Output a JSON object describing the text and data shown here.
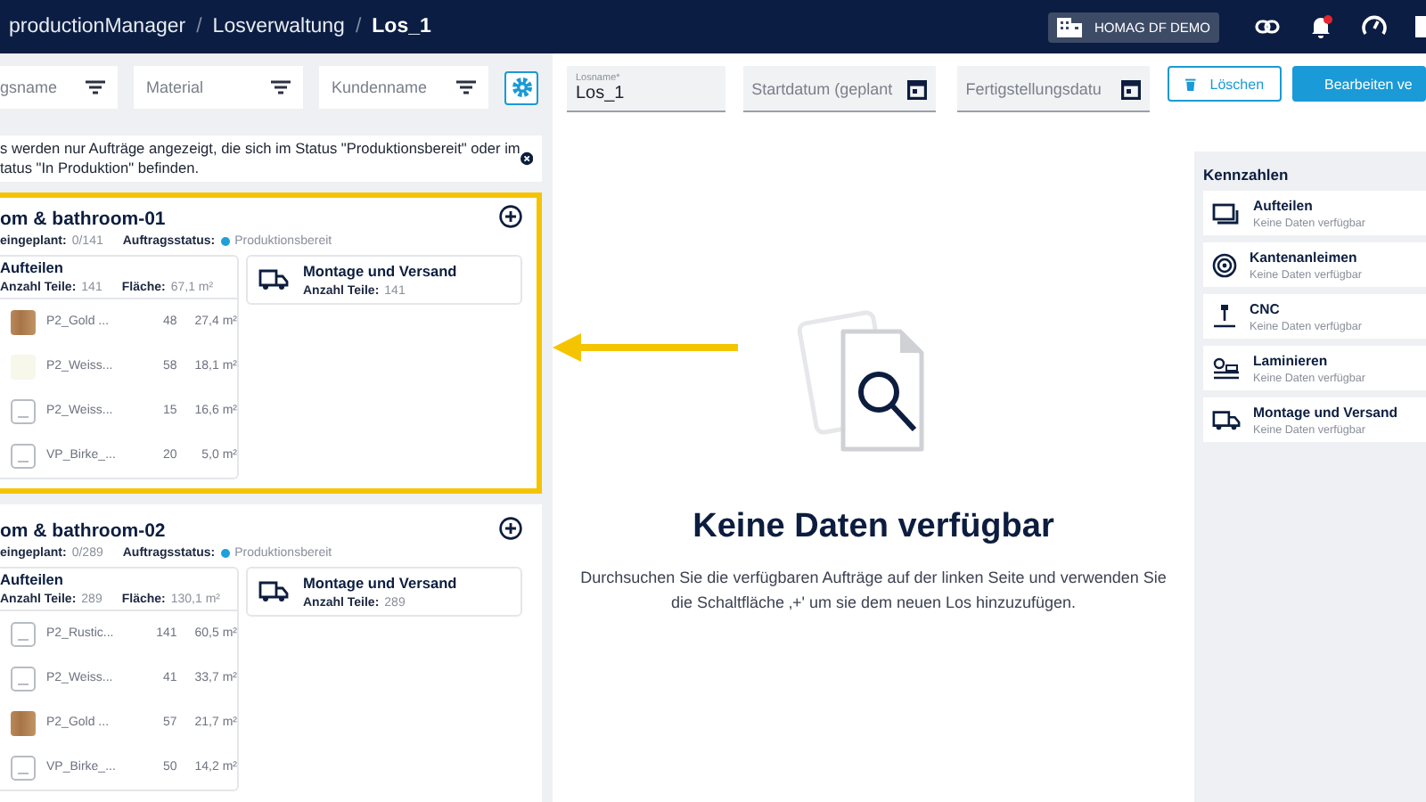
{
  "header": {
    "breadcrumbs": [
      {
        "label": "productionManager",
        "current": false
      },
      {
        "label": "Losverwaltung",
        "current": false
      },
      {
        "label": "Los_1",
        "current": true
      }
    ],
    "separator": "/",
    "tenant": "HOMAG DF DEMO",
    "notification_badge": true
  },
  "filters": [
    {
      "placeholder": "gsname"
    },
    {
      "placeholder": "Material"
    },
    {
      "placeholder": "Kundenname"
    }
  ],
  "notice": {
    "lines": [
      "s werden nur Aufträge angezeigt, die sich im Status \"Produktionsbereit\" oder im",
      "tatus \"In Produktion\" befinden."
    ]
  },
  "orders": [
    {
      "title": "om & bathroom-01",
      "highlighted": true,
      "planned_label": "eingeplant:",
      "planned": "0/141",
      "status_label": "Auftragsstatus:",
      "status": "Produktionsbereit",
      "color": "#1ea0d8",
      "split": {
        "title": "Aufteilen",
        "parts_label": "Anzahl Teile:",
        "parts": "141",
        "area_label": "Fläche:",
        "area": "67,1 m²",
        "materials": [
          {
            "kind": "wood",
            "name": "P2_Gold ...",
            "count": "48",
            "area": "27,4 m²"
          },
          {
            "kind": "light",
            "name": "P2_Weiss...",
            "count": "58",
            "area": "18,1 m²"
          },
          {
            "kind": "placeholder",
            "name": "P2_Weiss...",
            "count": "15",
            "area": "16,6 m²"
          },
          {
            "kind": "placeholder",
            "name": "VP_Birke_...",
            "count": "20",
            "area": "5,0 m²"
          }
        ]
      },
      "shipping": {
        "title": "Montage und Versand",
        "parts_label": "Anzahl Teile:",
        "parts": "141"
      }
    },
    {
      "title": "om & bathroom-02",
      "highlighted": false,
      "planned_label": "eingeplant:",
      "planned": "0/289",
      "status_label": "Auftragsstatus:",
      "status": "Produktionsbereit",
      "color": "#1ea0d8",
      "split": {
        "title": "Aufteilen",
        "parts_label": "Anzahl Teile:",
        "parts": "289",
        "area_label": "Fläche:",
        "area": "130,1 m²",
        "materials": [
          {
            "kind": "placeholder",
            "name": "P2_Rustic...",
            "count": "141",
            "area": "60,5 m²"
          },
          {
            "kind": "placeholder",
            "name": "P2_Weiss...",
            "count": "41",
            "area": "33,7 m²"
          },
          {
            "kind": "wood",
            "name": "P2_Gold ...",
            "count": "57",
            "area": "21,7 m²"
          },
          {
            "kind": "placeholder",
            "name": "VP_Birke_...",
            "count": "50",
            "area": "14,2 m²"
          }
        ]
      },
      "shipping": {
        "title": "Montage und Versand",
        "parts_label": "Anzahl Teile:",
        "parts": "289"
      }
    }
  ],
  "form": {
    "name_label": "Losname*",
    "name_value": "Los_1",
    "start_placeholder": "Startdatum (geplant",
    "finish_placeholder": "Fertigstellungsdatu"
  },
  "buttons": [
    {
      "kind": "delete",
      "label": "Löschen"
    },
    {
      "kind": "edit",
      "label": "Bearbeiten ve"
    }
  ],
  "empty_state": {
    "title": "Keine Daten verfügbar",
    "text": "Durchsuchen Sie die verfügbaren Aufträge auf der linken Seite und verwenden Sie die Schaltfläche ‚+' um sie dem neuen Los hinzuzufügen."
  },
  "kpis": {
    "title": "Kennzahlen",
    "items": [
      {
        "kind": "split",
        "title": "Aufteilen",
        "subtitle": "Keine Daten verfügbar"
      },
      {
        "kind": "edgeband",
        "title": "Kantenanleimen",
        "subtitle": "Keine Daten verfügbar"
      },
      {
        "kind": "cnc",
        "title": "CNC",
        "subtitle": "Keine Daten verfügbar"
      },
      {
        "kind": "laminate",
        "title": "Laminieren",
        "subtitle": "Keine Daten verfügbar"
      },
      {
        "kind": "truck",
        "title": "Montage und Versand",
        "subtitle": "Keine Daten verfügbar"
      }
    ]
  }
}
